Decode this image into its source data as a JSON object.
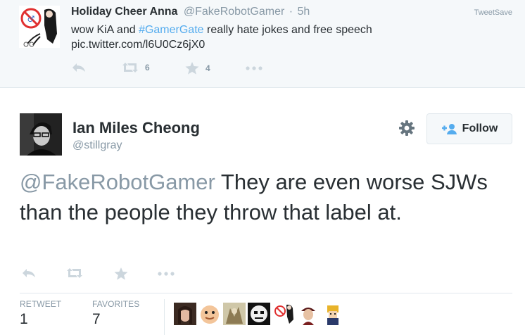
{
  "parent_tweet": {
    "name": "Holiday Cheer Anna",
    "handle": "@FakeRobotGamer",
    "separator": "·",
    "time": "5h",
    "widget_label": "TweetSave",
    "text_before": "wow KiA and ",
    "hashtag": "#GamerGate",
    "text_after": " really hate jokes and free speech",
    "link": "pic.twitter.com/l6U0Cz6jX0",
    "retweets": "6",
    "favorites": "4",
    "icons": [
      "reply-icon",
      "retweet-icon",
      "favorite-icon",
      "more-icon"
    ]
  },
  "main_tweet": {
    "name": "Ian Miles Cheong",
    "handle": "@stillgray",
    "follow_label": "Follow",
    "mention": "@FakeRobotGamer",
    "text": " They are even worse SJWs than the people they throw that label at.",
    "stats": {
      "retweet_label": "RETWEET",
      "retweet_count": "1",
      "favorites_label": "FAVORITES",
      "favorites_count": "7"
    },
    "icons": [
      "reply-icon",
      "retweet-icon",
      "favorite-icon",
      "more-icon",
      "gear-icon",
      "follow-person-icon"
    ]
  },
  "colors": {
    "link_blue": "#55acee",
    "muted_gray": "#8899a6",
    "text": "#292f33",
    "header_bg": "#f5f8fa",
    "border": "#e1e8ed"
  }
}
